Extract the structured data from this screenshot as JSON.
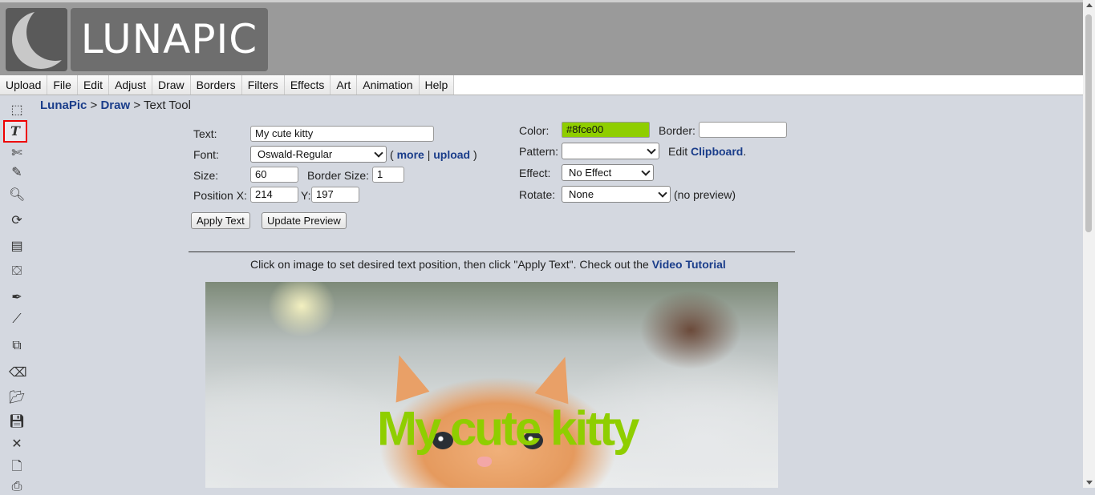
{
  "app": {
    "logo_text": "LUNAPIC"
  },
  "menu": [
    "Upload",
    "File",
    "Edit",
    "Adjust",
    "Draw",
    "Borders",
    "Filters",
    "Effects",
    "Art",
    "Animation",
    "Help"
  ],
  "toolbar": [
    {
      "name": "select-icon",
      "glyph": "⬚"
    },
    {
      "name": "text-tool-icon",
      "glyph": "T"
    },
    {
      "name": "crop-scissors-icon",
      "glyph": "✄"
    },
    {
      "name": "pencil-icon",
      "glyph": "✎"
    },
    {
      "name": "zoom-icon",
      "glyph": "🔍︎"
    },
    {
      "name": "rotate-icon",
      "glyph": "⟳"
    },
    {
      "name": "layers-icon",
      "glyph": "▤"
    },
    {
      "name": "paint-bucket-icon",
      "glyph": "⛋"
    },
    {
      "name": "eyedropper-icon",
      "glyph": "✒"
    },
    {
      "name": "brush-icon",
      "glyph": "⟋"
    },
    {
      "name": "resize-icon",
      "glyph": "⧉"
    },
    {
      "name": "eraser-icon",
      "glyph": "⌫"
    },
    {
      "name": "open-folder-icon",
      "glyph": "📂︎"
    },
    {
      "name": "save-icon",
      "glyph": "💾︎"
    },
    {
      "name": "close-icon",
      "glyph": "✕"
    },
    {
      "name": "new-file-icon",
      "glyph": "🗋"
    },
    {
      "name": "print-icon",
      "glyph": "⎙"
    }
  ],
  "breadcrumb": {
    "home": "LunaPic",
    "sep1": ">",
    "section": "Draw",
    "sep2": ">",
    "current": "Text Tool"
  },
  "form": {
    "text_label": "Text:",
    "text_value": "My cute kitty",
    "font_label": "Font:",
    "font_value": "Oswald-Regular",
    "font_more_open": "(",
    "font_more": "more",
    "font_sep": "|",
    "font_upload": "upload",
    "font_more_close": ")",
    "size_label": "Size:",
    "size_value": "60",
    "border_size_label": "Border Size:",
    "border_size_value": "1",
    "posx_label": "Position X:",
    "posx_value": "214",
    "posy_label": "Y:",
    "posy_value": "197",
    "apply_button": "Apply Text",
    "preview_button": "Update Preview",
    "color_label": "Color:",
    "color_value": "#8fce00",
    "border_label": "Border:",
    "border_value": "",
    "pattern_label": "Pattern:",
    "pattern_value": "",
    "edit_label": "Edit",
    "clipboard_link": "Clipboard",
    "clipboard_period": ".",
    "effect_label": "Effect:",
    "effect_value": "No Effect",
    "rotate_label": "Rotate:",
    "rotate_value": "None",
    "no_preview": "(no preview)"
  },
  "instruction": {
    "text": "Click on image to set desired text position, then click \"Apply Text\". Check out the ",
    "link": "Video Tutorial"
  },
  "canvas": {
    "overlay_text": "My cute kitty",
    "overlay_color": "#8fce00"
  },
  "colors": {
    "accent_link": "#1a3d8a",
    "selected_tool_border": "#e00000",
    "header_bg": "#9a9a9a",
    "page_bg": "#d4d8e0"
  }
}
